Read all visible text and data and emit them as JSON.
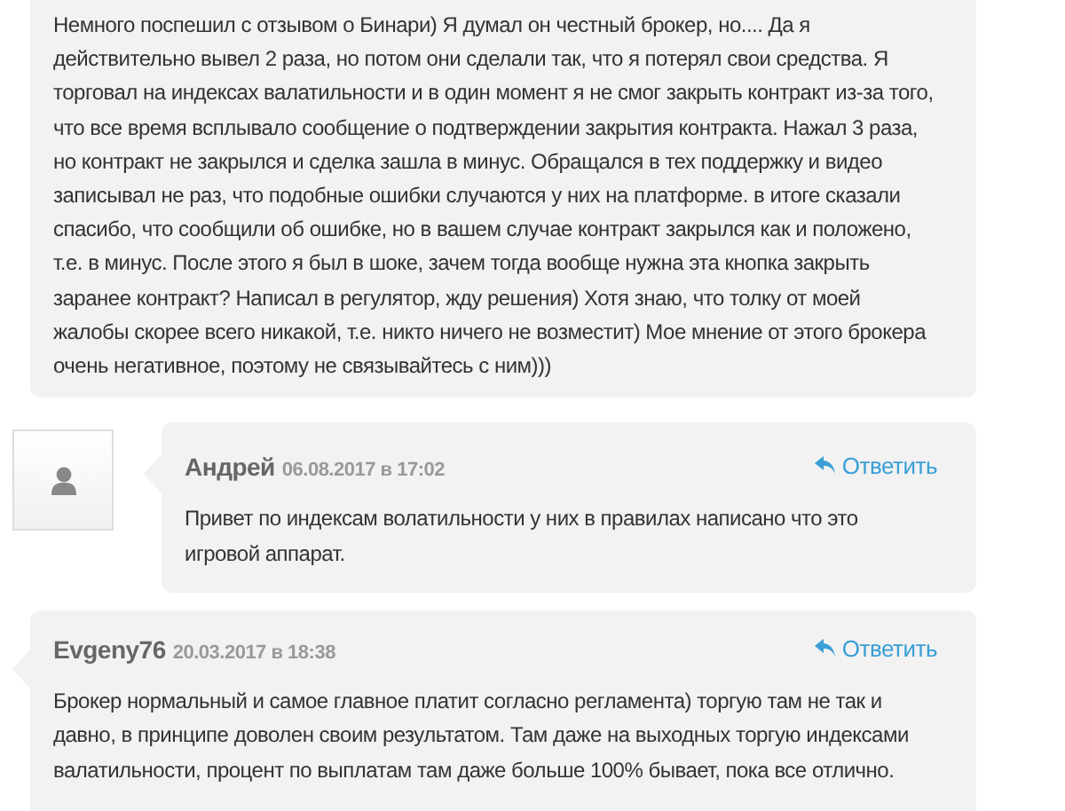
{
  "comments": [
    {
      "kind": "continued",
      "body": "Немного поспешил с отзывом о Бинари) Я думал он честный брокер, но.... Да я действительно вывел 2 раза, но потом они сделали так, что я потерял свои средства. Я торговал на индексах валатильности и в один момент я не смог закрыть контракт из-за того, что все время всплывало сообщение о подтверждении закрытия контракта. Нажал 3 раза, но контракт не закрылся и сделка зашла в минус. Обращался в тех поддержку и видео записывал не раз, что подобные ошибки случаются у них на платформе. в итоге сказали спасибо, что сообщили об ошибке, но в вашем случае контракт закрылся как и положено, т.е. в минус. После этого я был в шоке, зачем тогда вообще нужна эта кнопка закрыть заранее контракт? Написал в регулятор, жду решения) Хотя знаю, что толку от моей жалобы скорее всего никакой, т.е. никто ничего не возместит) Мое мнение от этого брокера очень негативное, поэтому не связывайтесь с ним)))"
    },
    {
      "kind": "nested",
      "author": "Андрей",
      "date": "06.08.2017 в 17:02",
      "reply": "Ответить",
      "body": "Привет по индексам волатильности у них в правилах написано что это игровой аппарат."
    },
    {
      "kind": "top",
      "author": "Evgeny76",
      "date": "20.03.2017 в 18:38",
      "reply": "Ответить",
      "body": "Брокер нормальный и самое главное платит согласно регламента) торгую там не так и давно, в принципе доволен своим результатом. Там даже на выходных торгую индексами валатильности, процент по выплатам там даже больше 100% бывает, пока все отлично."
    }
  ]
}
